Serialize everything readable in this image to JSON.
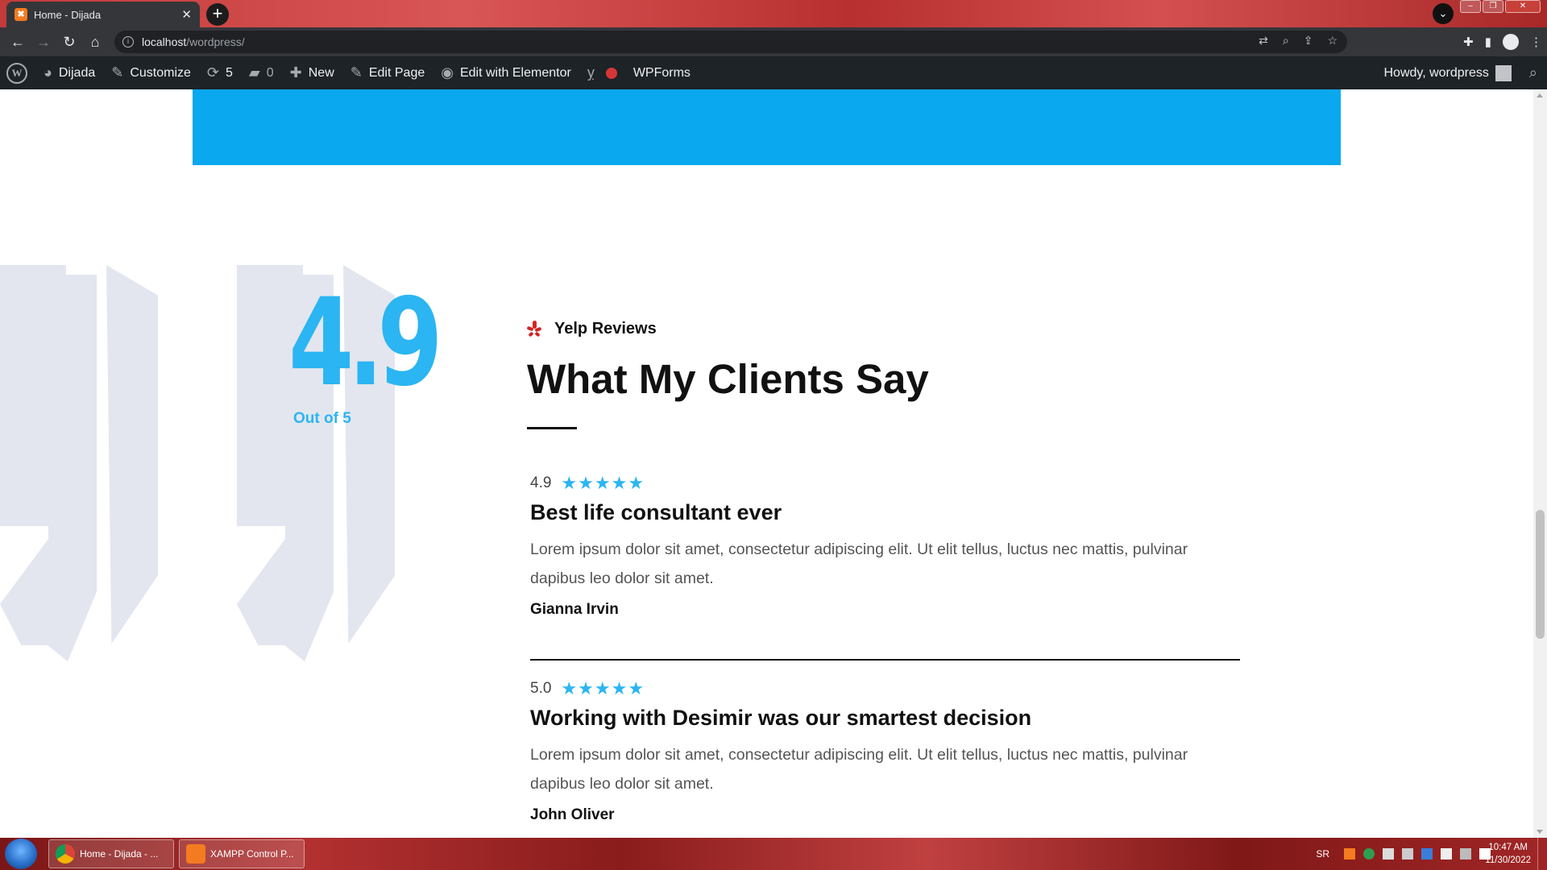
{
  "browser": {
    "tab_title": "Home - Dijada",
    "url_host": "localhost",
    "url_path": "/wordpress/"
  },
  "adminbar": {
    "site_name": "Dijada",
    "customize": "Customize",
    "updates_count": "5",
    "comments_count": "0",
    "new": "New",
    "edit_page": "Edit Page",
    "edit_elementor": "Edit with Elementor",
    "wpforms": "WPForms",
    "howdy": "Howdy, wordpress"
  },
  "reviews_section": {
    "rating": "4.9",
    "out_of": "Out of 5",
    "source_label": "Yelp Reviews",
    "heading": "What My Clients Say",
    "reviews": [
      {
        "score": "4.9",
        "stars": 5,
        "title": "Best life consultant ever",
        "text": "Lorem ipsum dolor sit amet, consectetur adipiscing elit. Ut elit tellus, luctus nec mattis, pulvinar dapibus leo dolor sit amet.",
        "author": "Gianna Irvin"
      },
      {
        "score": "5.0",
        "stars": 5,
        "title": "Working with Desimir was our smartest decision",
        "text": "Lorem ipsum dolor sit amet, consectetur adipiscing elit. Ut elit tellus, luctus nec mattis, pulvinar dapibus leo dolor sit amet.",
        "author": "John Oliver"
      }
    ],
    "accent_color": "#2bb5f2"
  },
  "taskbar": {
    "tasks": [
      "Home - Dijada - ...",
      "XAMPP Control P..."
    ],
    "language": "SR",
    "time": "10:47 AM",
    "date": "11/30/2022"
  }
}
